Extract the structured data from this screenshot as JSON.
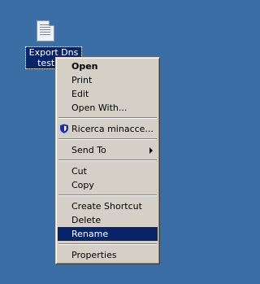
{
  "desktop": {
    "file_icon": {
      "label": "Export Dns test.txt",
      "icon": "text-file-icon"
    }
  },
  "context_menu": {
    "items": [
      {
        "label": "Open",
        "default": true
      },
      {
        "label": "Print"
      },
      {
        "label": "Edit"
      },
      {
        "label": "Open With..."
      },
      {
        "label": "Ricerca minacce...",
        "icon": "antivirus-shield-icon"
      },
      {
        "label": "Send To",
        "submenu": true
      },
      {
        "label": "Cut"
      },
      {
        "label": "Copy"
      },
      {
        "label": "Create Shortcut"
      },
      {
        "label": "Delete"
      },
      {
        "label": "Rename",
        "highlighted": true
      },
      {
        "label": "Properties"
      }
    ]
  },
  "colors": {
    "desktop": "#3a6ea5",
    "selection": "#0a246a",
    "menu_face": "#d4d0c8",
    "shield": "#1b2fa8"
  }
}
